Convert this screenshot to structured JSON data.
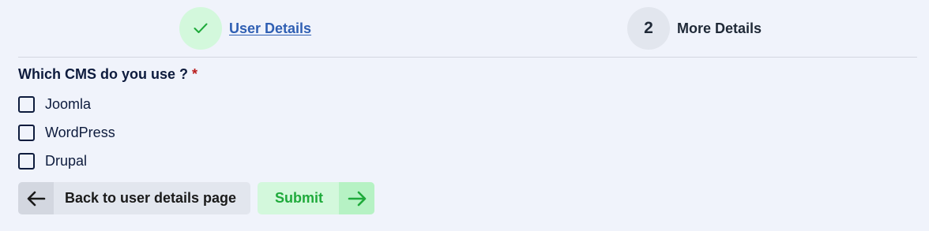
{
  "stepper": {
    "steps": [
      {
        "label": "User Details",
        "status": "completed",
        "icon": "check-icon"
      },
      {
        "number": "2",
        "label": "More Details",
        "status": "current"
      }
    ]
  },
  "question": {
    "text": "Which CMS do you use ?",
    "required_marker": "*"
  },
  "options": [
    {
      "label": "Joomla",
      "checked": false
    },
    {
      "label": "WordPress",
      "checked": false
    },
    {
      "label": "Drupal",
      "checked": false
    }
  ],
  "buttons": {
    "back_label": "Back to user details page",
    "back_icon": "arrow-left-icon",
    "submit_label": "Submit",
    "submit_icon": "arrow-right-icon"
  },
  "colors": {
    "background": "#f0f3fb",
    "success": "#1faa3b",
    "success_bg": "#d3f8dc",
    "link": "#2f5fb3",
    "required": "#b91c1c",
    "text": "#0d1b3d"
  }
}
